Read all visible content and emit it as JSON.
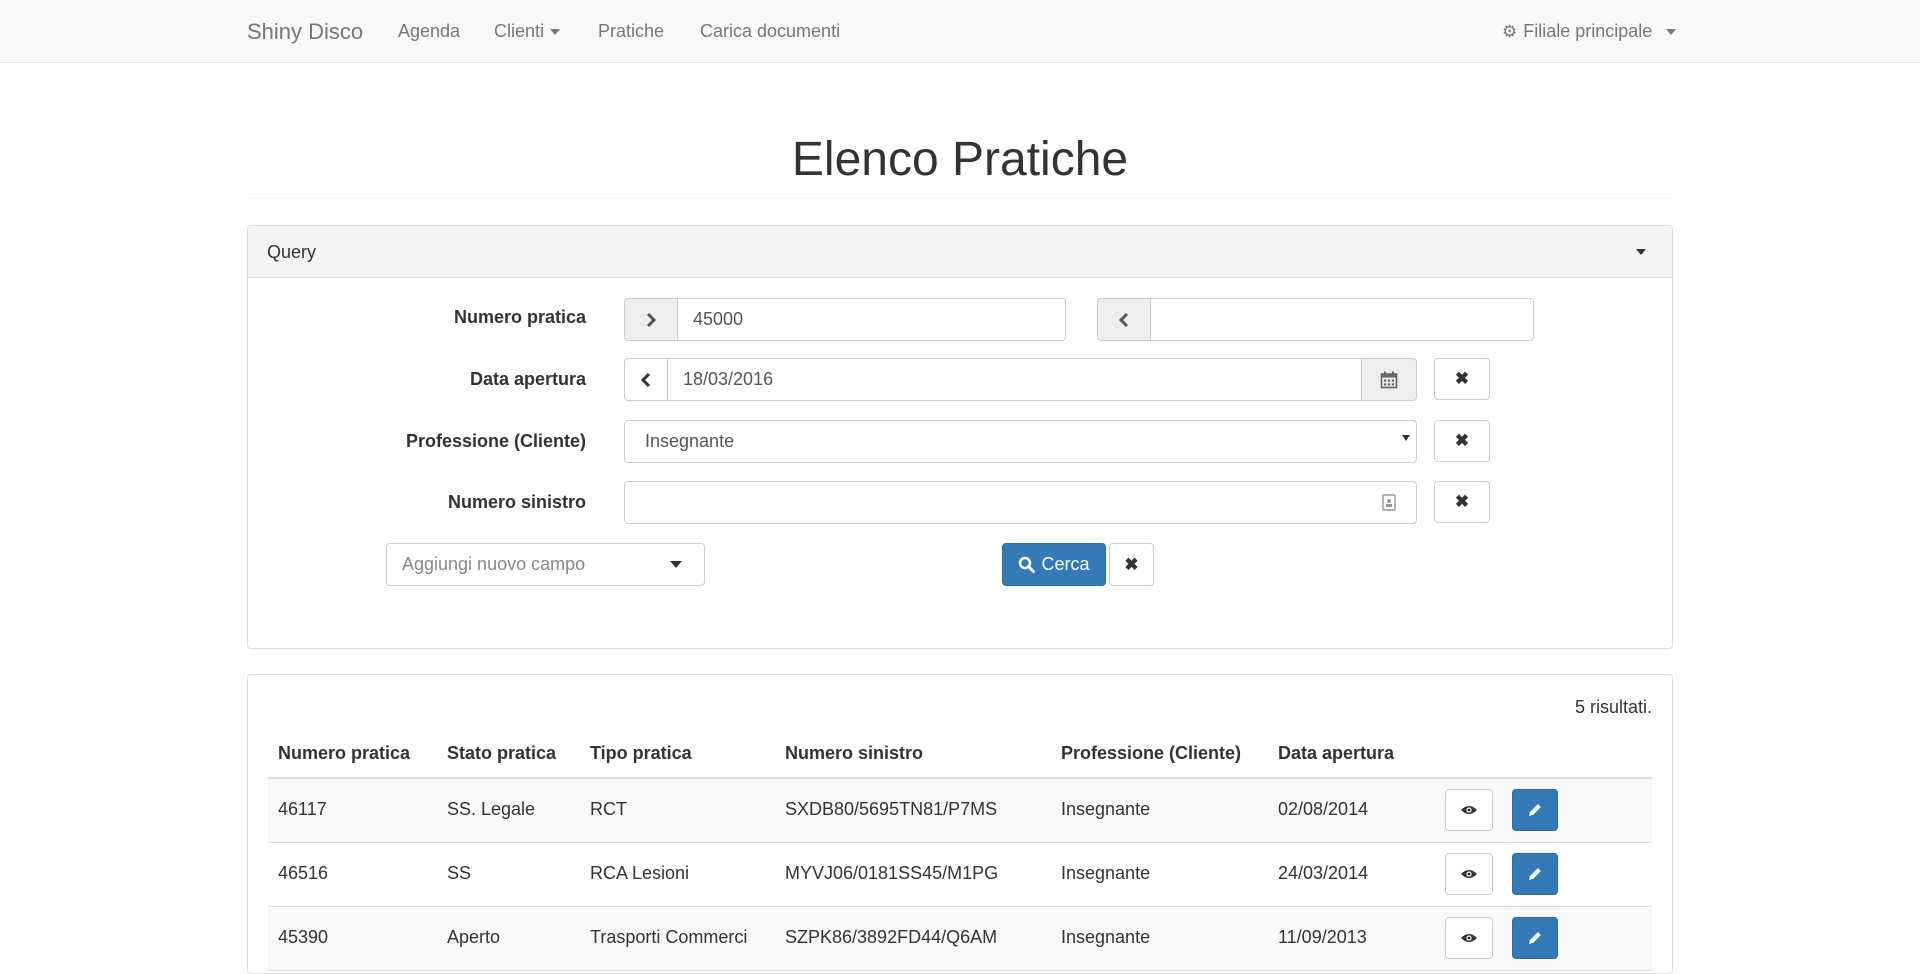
{
  "navbar": {
    "brand": "Shiny Disco",
    "items": [
      {
        "label": "Agenda"
      },
      {
        "label": "Clienti"
      },
      {
        "label": "Pratiche"
      },
      {
        "label": "Carica documenti"
      }
    ],
    "branch": "Filiale principale"
  },
  "page": {
    "title": "Elenco Pratiche"
  },
  "query": {
    "title": "Query",
    "numero_pratica": {
      "label": "Numero pratica",
      "from_value": "45000",
      "to_value": ""
    },
    "data_apertura": {
      "label": "Data apertura",
      "value": "18/03/2016"
    },
    "professione": {
      "label": "Professione (Cliente)",
      "value": "Insegnante"
    },
    "numero_sinistro": {
      "label": "Numero sinistro",
      "value": ""
    },
    "add_field": {
      "placeholder": "Aggiungi nuovo campo"
    },
    "search_button": "Cerca"
  },
  "results": {
    "count_text": "5 risultati.",
    "columns": [
      "Numero pratica",
      "Stato pratica",
      "Tipo pratica",
      "Numero sinistro",
      "Professione (Cliente)",
      "Data apertura"
    ],
    "rows": [
      {
        "numero": "46117",
        "stato": "SS. Legale",
        "tipo": "RCT",
        "sinistro": "SXDB80/5695TN81/P7MS",
        "professione": "Insegnante",
        "data": "02/08/2014"
      },
      {
        "numero": "46516",
        "stato": "SS",
        "tipo": "RCA Lesioni",
        "sinistro": "MYVJ06/0181SS45/M1PG",
        "professione": "Insegnante",
        "data": "24/03/2014"
      },
      {
        "numero": "45390",
        "stato": "Aperto",
        "tipo": "Trasporti Commerci",
        "sinistro": "SZPK86/3892FD44/Q6AM",
        "professione": "Insegnante",
        "data": "11/09/2013"
      }
    ]
  },
  "colors": {
    "primary": "#337ab7",
    "navbar_bg": "#f8f8f8",
    "panel_heading_bg": "#f5f5f5"
  },
  "icons": {
    "branch": "gear-icon",
    "search": "search-icon",
    "clear": "close-icon",
    "calendar": "calendar-icon",
    "view": "eye-icon",
    "edit": "pencil-icon"
  }
}
